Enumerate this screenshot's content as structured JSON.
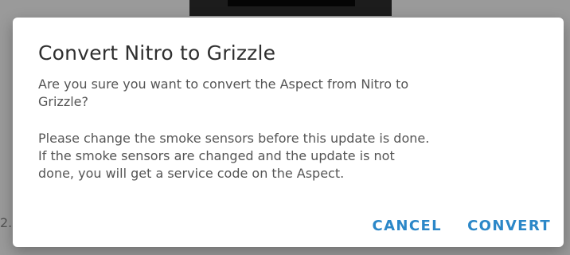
{
  "backdrop": {
    "fragment_text": "2."
  },
  "dialog": {
    "title": "Convert Nitro to Grizzle",
    "paragraph_1": "Are you sure you want to convert the Aspect from Nitro to\nGrizzle?",
    "paragraph_2": "Please change the smoke sensors before this update is done.\nIf the smoke sensors are changed and the update is not\ndone, you will get a service code on the Aspect.",
    "actions": {
      "cancel_label": "CANCEL",
      "convert_label": "CONVERT"
    }
  },
  "colors": {
    "overlay": "#9a9a9a",
    "accent": "#2b87c8",
    "title": "#2f2f2f",
    "body_text": "#555555"
  }
}
